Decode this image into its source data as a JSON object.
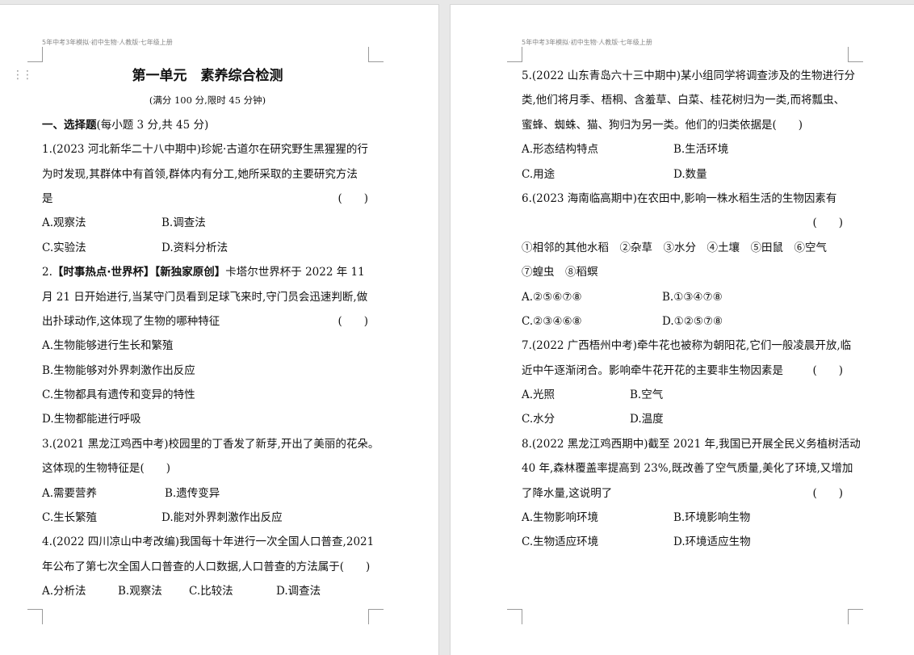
{
  "header_text": "5年中考3年模拟·初中生物·人教版·七年级上册",
  "left": {
    "title": "第一单元　素养综合检测",
    "subtitle": "(满分 100 分,限时 45 分钟)",
    "section_title": "一、选择题",
    "section_note": "(每小题 3 分,共 45 分)",
    "q1": {
      "l1": "1.(2023 河北新华二十八中期中)珍妮·古道尔在研究野生黑猩猩的行",
      "l2": "为时发现,其群体中有首领,群体内有分工,她所采取的主要研究方法",
      "l3": "是",
      "bracket": "(　　)",
      "a": "A.观察法",
      "b": "B.调查法",
      "c": "C.实验法",
      "d": "D.资料分析法"
    },
    "q2": {
      "num": "2.",
      "tag1": "【时事热点·世界杯】",
      "tag2": "【新独家原创】",
      "l1_rest": "卡塔尔世界杯于 2022 年 11",
      "l2": "月 21 日开始进行,当某守门员看到足球飞来时,守门员会迅速判断,做",
      "l3": "出扑球动作,这体现了生物的哪种特征",
      "bracket": "(　　)",
      "a": "A.生物能够进行生长和繁殖",
      "b": "B.生物能够对外界刺激作出反应",
      "c": "C.生物都具有遗传和变异的特性",
      "d": "D.生物都能进行呼吸"
    },
    "q3": {
      "l1": "3.(2021 黑龙江鸡西中考)校园里的丁香发了新芽,开出了美丽的花朵。",
      "l2": "这体现的生物特征是(　　)",
      "a": "A.需要营养",
      "b": "B.遗传变异",
      "c": "C.生长繁殖",
      "d": "D.能对外界刺激作出反应"
    },
    "q4": {
      "l1": "4.(2022 四川凉山中考改编)我国每十年进行一次全国人口普查,2021",
      "l2": "年公布了第七次全国人口普查的人口数据,人口普查的方法属于(　　)",
      "a": "A.分析法",
      "b": "B.观察法",
      "c": "C.比较法",
      "d": "D.调查法"
    }
  },
  "right": {
    "q5": {
      "l1": "5.(2022 山东青岛六十三中期中)某小组同学将调查涉及的生物进行分",
      "l2": "类,他们将月季、梧桐、含羞草、白菜、桂花树归为一类,而将瓢虫、",
      "l3": "蜜蜂、蜘蛛、猫、狗归为另一类。他们的归类依据是(　　)",
      "a": "A.形态结构特点",
      "b": "B.生活环境",
      "c": "C.用途",
      "d": "D.数量"
    },
    "q6": {
      "l1": "6.(2023 海南临高期中)在农田中,影响一株水稻生活的生物因素有",
      "bracket": "(　　)",
      "items1": "①相邻的其他水稻　②杂草　③水分　④土壤　⑤田鼠　⑥空气",
      "items2": "⑦蝗虫　⑧稻螟",
      "a": "A.②⑤⑥⑦⑧",
      "b": "B.①③④⑦⑧",
      "c": "C.②③④⑥⑧",
      "d": "D.①②⑤⑦⑧"
    },
    "q7": {
      "l1": "7.(2022 广西梧州中考)牵牛花也被称为朝阳花,它们一般凌晨开放,临",
      "l2": "近中午逐渐闭合。影响牵牛花开花的主要非生物因素是",
      "bracket": "(　　)",
      "a": "A.光照",
      "b": "B.空气",
      "c": "C.水分",
      "d": "D.温度"
    },
    "q8": {
      "l1": "8.(2022 黑龙江鸡西期中)截至 2021 年,我国已开展全民义务植树活动",
      "l2": "40 年,森林覆盖率提高到 23%,既改善了空气质量,美化了环境,又增加",
      "l3": "了降水量,这说明了",
      "bracket": "(　　)",
      "a": "A.生物影响环境",
      "b": "B.环境影响生物",
      "c": "C.生物适应环境",
      "d": "D.环境适应生物"
    }
  }
}
